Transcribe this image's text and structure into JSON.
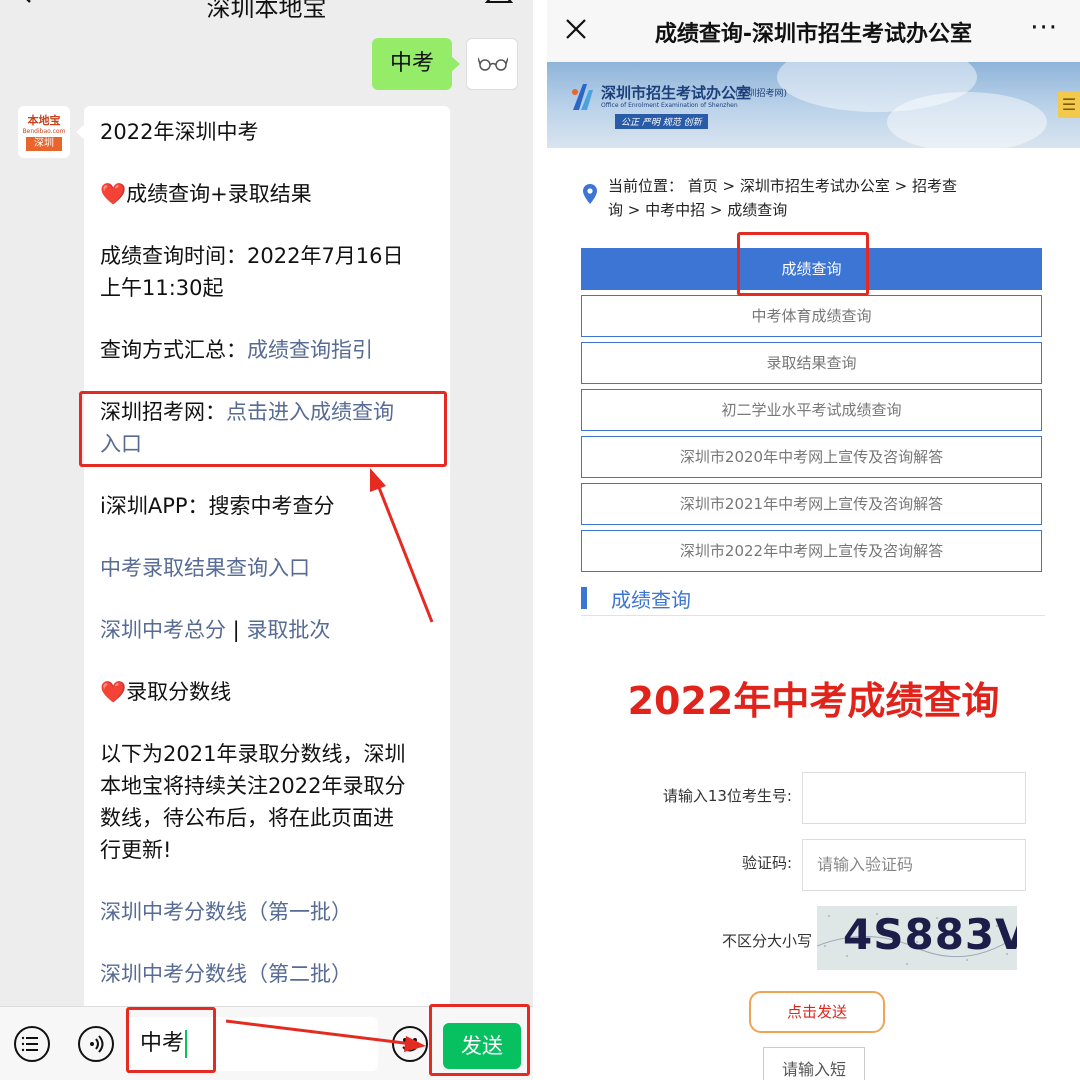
{
  "chat": {
    "title": "深圳本地宝",
    "outgoing_message": "中考",
    "bot_avatar": {
      "brand": "本地宝",
      "domain": "Bendibao.com",
      "city": "深圳"
    },
    "message": {
      "l1": "2022年深圳中考",
      "l2": "成绩查询+录取结果",
      "l3a": "成绩查询时间：2022年7月16日",
      "l3b": "上午11:30起",
      "l4_prefix": "查询方式汇总：",
      "l4_link": "成绩查询指引",
      "l5_prefix": "深圳招考网：",
      "l5_link_a": "点击进入成绩查询",
      "l5_link_b": "入口",
      "l6": "i深圳APP：搜索中考查分",
      "l7_link": "中考录取结果查询入口",
      "l8_link_a": "深圳中考总分",
      "l8_sep": " | ",
      "l8_link_b": "录取批次",
      "l9": "录取分数线",
      "l10a": "以下为2021年录取分数线，深圳",
      "l10b": "本地宝将持续关注2022年录取分",
      "l10c": "数线，待公布后，将在此页面进",
      "l10d": "行更新!",
      "l11_link": "深圳中考分数线（第一批）",
      "l12_link": "深圳中考分数线（第二批）"
    },
    "input_value": "中考",
    "send_label": "发送"
  },
  "web": {
    "title": "成绩查询-深圳市招生考试办公室",
    "more": "···",
    "banner": {
      "org_name": "深圳市招生考试办公室",
      "org_tag": "(深圳招考网)",
      "org_en": "Office of Enrolment Examination of Shenzhen",
      "slogan": "公正 严明 规范 创新",
      "menu": "☰"
    },
    "breadcrumb": {
      "line1": "当前位置：  首页  >  深圳市招生考试办公室  >  招考查",
      "line2": "询  >  中考中招  >  成绩查询"
    },
    "nav": [
      {
        "label": "成绩查询"
      },
      {
        "label": "中考体育成绩查询"
      },
      {
        "label": "录取结果查询"
      },
      {
        "label": "初二学业水平考试成绩查询"
      },
      {
        "label": "深圳市2020年中考网上宣传及咨询解答"
      },
      {
        "label": "深圳市2021年中考网上宣传及咨询解答"
      },
      {
        "label": "深圳市2022年中考网上宣传及咨询解答"
      }
    ],
    "section_title": "成绩查询",
    "big_title": "2022年中考成绩查询",
    "form": {
      "exam_no_label": "请输入13位考生号:",
      "exam_no_value": "",
      "captcha_label": "验证码:",
      "captcha_placeholder": "请输入验证码",
      "case_hint": "不区分大小写",
      "captcha_text": "4S883V",
      "sms_button": "点击发送",
      "sms_placeholder": "请输入短"
    }
  },
  "colors": {
    "wechat_green": "#07c160",
    "bubble_green": "#95ec69",
    "link_blue": "#576b95",
    "nav_blue": "#3d75d4",
    "highlight_red": "#e52a21",
    "title_red": "#e0241b"
  }
}
